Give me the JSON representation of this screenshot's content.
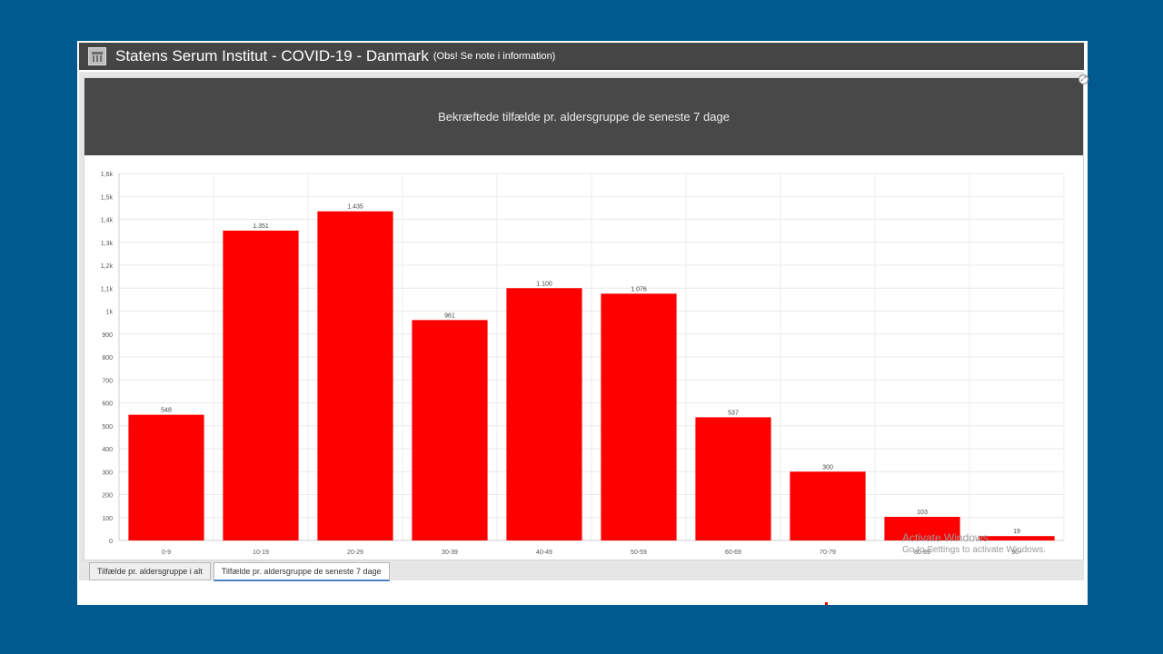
{
  "window": {
    "title": "Statens Serum Institut - COVID-19 - Danmark",
    "note": "(Obs! Se note i information)"
  },
  "tabs": [
    {
      "label": "Tilfælde pr. aldersgruppe i alt",
      "active": false
    },
    {
      "label": "Tilfælde pr. aldersgruppe de seneste 7 dage",
      "active": true
    }
  ],
  "watermark": {
    "line1": "Activate Windows",
    "line2": "Go to Settings to activate Windows."
  },
  "chart_data": {
    "type": "bar",
    "title": "Bekræftede tilfælde pr. aldersgruppe de seneste 7 dage",
    "categories": [
      "0-9",
      "10-19",
      "20-29",
      "30-39",
      "40-49",
      "50-59",
      "60-69",
      "70-79",
      "80-89",
      "90+"
    ],
    "values": [
      548,
      1351,
      1435,
      961,
      1100,
      1076,
      537,
      300,
      103,
      19
    ],
    "value_labels": [
      "548",
      "1.351",
      "1.435",
      "961",
      "1.100",
      "1.076",
      "537",
      "300",
      "103",
      "19"
    ],
    "ylim": [
      0,
      1600
    ],
    "yticks": [
      0,
      100,
      200,
      300,
      400,
      500,
      600,
      700,
      800,
      900,
      1000,
      1100,
      1200,
      1300,
      1400,
      1500,
      1600
    ],
    "ytick_labels": [
      "0",
      "100",
      "200",
      "300",
      "400",
      "500",
      "600",
      "700",
      "800",
      "900",
      "1k",
      "1,1k",
      "1,2k",
      "1,3k",
      "1,4k",
      "1,5k",
      "1,6k"
    ],
    "xlabel": "",
    "ylabel": "",
    "grid": true,
    "bar_color": "#ff0000"
  }
}
